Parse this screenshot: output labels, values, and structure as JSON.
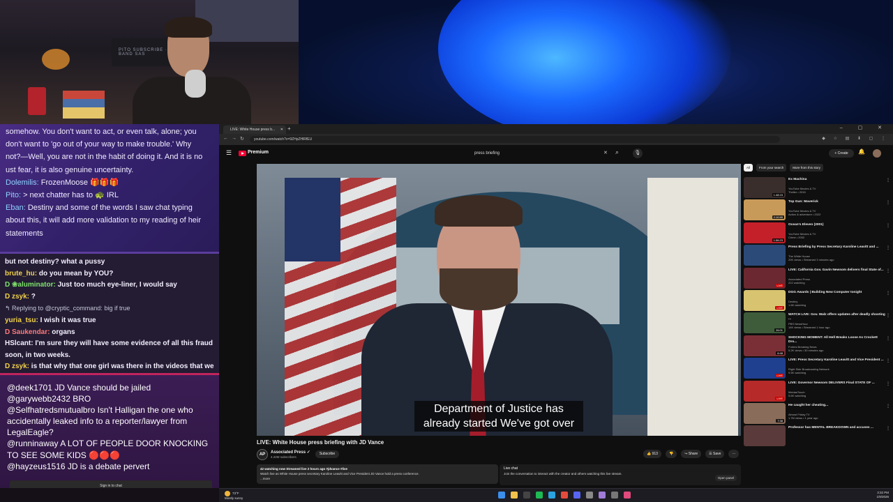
{
  "webcam": {
    "sign_text": "PITO SUBSCRIBE · BAND SAS"
  },
  "chat_top": {
    "lines": [
      "somehow. You don't want to act, or even talk, alone; you",
      "don't want to 'go out of your way to make trouble.' Why",
      "not?—Well, you are not in the habit of doing it. And it is no",
      "ust fear, it is also genuine uncertainty."
    ],
    "messages": [
      {
        "user": "Dolemilis:",
        "text": "FrozenMoose 🎁🎁🎁"
      },
      {
        "user": "Pito:",
        "text": "> next chatter has to 🐢 IRL"
      },
      {
        "user": "Eban:",
        "text": "Destiny and some of the words I saw chat typing about this, it will add more validation to my reading of heir statements"
      }
    ]
  },
  "chat_mid": {
    "messages": [
      {
        "user": "",
        "text": "but not destiny? what a pussy"
      },
      {
        "user": "brute_hu:",
        "text": "do you mean by YOU?"
      },
      {
        "user": "D ❀aluminator:",
        "text": "Just too much eye-liner, I would say"
      },
      {
        "user": "D zsyk:",
        "text": "?"
      },
      {
        "user": "↰ Replying to @cryptic_command:",
        "text": "big if true"
      },
      {
        "user": "yuria_tsu:",
        "text": "I wish it was true"
      },
      {
        "user": "D Saukendar:",
        "text": "organs"
      },
      {
        "user": "HSlcant:",
        "text": "I'm sure they will have some evidence of all this fraud soon, in two weeks."
      },
      {
        "user": "D zsyk:",
        "text": "is that why that one girl was there in the videos that we were watching this morning with dan and moot????"
      }
    ]
  },
  "chat_bottom": {
    "messages": [
      {
        "user": "@deek1701",
        "text": "JD Vance should be jailed"
      },
      {
        "user": "@garywebb2432",
        "text": "BRO"
      },
      {
        "user": "@Selfhatredsmutualbro",
        "text": "Isn't Halligan the one who accidentally leaked info to a reporter/lawyer from LegalEagle?"
      },
      {
        "user": "@runninaway",
        "text": "A LOT OF PEOPLE DOOR KNOCKING TO SEE SOME KIDS 🔴🔴🔴"
      },
      {
        "user": "@hayzeus1516",
        "text": "JD is a debate pervert"
      }
    ],
    "signin": "Sign in to chat"
  },
  "browser": {
    "tab_title": "LIVE: White House press b...",
    "url": "youtube.com/watch?v=9ZHpZHlRfEU",
    "new_tab": "+",
    "window_controls": "– ▢ ✕"
  },
  "youtube": {
    "brand": "Premium",
    "search_value": "press briefing",
    "create_label": "+ Create",
    "caption_line1": "Department of Justice has",
    "caption_line2": "already started We've got over",
    "video_title": "LIVE: White House press briefing with JD Vance",
    "channel_name": "Associated Press ✓",
    "channel_avatar": "AP",
    "channel_subs": "4.22M subscribers",
    "subscribe_label": "Subscribe",
    "likes": "👍 913",
    "dislike": "👎",
    "share": "↪ Share",
    "save": "☰ Save",
    "more": "···",
    "desc_stats": "42 watching now  Streamed live 2 hours ago  #jdvance #live",
    "desc_text": "Watch live as White House press secretary Karoline Leavitt and Vice President JD Vance hold a press conference.",
    "desc_more": "...more",
    "livechat_title": "Live chat",
    "livechat_text": "Join the conversation to interact with the creator and others watching this live stream.",
    "open_panel": "Open panel"
  },
  "sidebar": {
    "chips": [
      "All",
      "From your search",
      "More from this story"
    ],
    "recommendations": [
      {
        "title": "Ex Machina",
        "channel": "YouTube Movies & TV",
        "meta": "Thriller • 2015",
        "badge": "1:48:15",
        "live": false,
        "color": "#3a2e2c"
      },
      {
        "title": "Top Gun: Maverick",
        "channel": "YouTube Movies & TV",
        "meta": "Action & adventure • 2022",
        "badge": "2:10:55",
        "live": false,
        "color": "#c89a5a"
      },
      {
        "title": "Ocean's Eleven (2001)",
        "channel": "YouTube Movies & TV",
        "meta": "Crime • 2002",
        "badge": "1:56:23",
        "live": false,
        "color": "#c4202a"
      },
      {
        "title": "Press Briefing by Press Secretary Karoline Leavitt and ...",
        "channel": "The White House",
        "meta": "20K views • Streamed 3 minutes ago",
        "badge": "",
        "live": false,
        "color": "#2b4a78"
      },
      {
        "title": "LIVE: California Gov. Gavin Newsom delivers final State of...",
        "channel": "Associated Press",
        "meta": "222 watching",
        "badge": "LIVE",
        "live": true,
        "color": "#6b2830"
      },
      {
        "title": "DGG Awards | Building New Computer tonight",
        "channel": "Destiny",
        "meta": "1.6K watching",
        "badge": "LIVE",
        "live": true,
        "color": "#d8c470"
      },
      {
        "title": "WATCH LIVE: Gov. Walz offers updates after deadly shooting ...",
        "channel": "PBS NewsHour",
        "meta": "14K views • Streamed 1 hour ago",
        "badge": "26:01",
        "live": false,
        "color": "#3e5c3a"
      },
      {
        "title": "SHOCKING MOMENT: All Hell Breaks Loose As Crockett Dro...",
        "channel": "Forbes Breaking News",
        "meta": "5.2K views • 30 minutes ago",
        "badge": "6:48",
        "live": false,
        "color": "#7a2f36"
      },
      {
        "title": "LIVE: Press Secretary Karoline Leavitt and Vice President ...",
        "channel": "Right Side Broadcasting Network",
        "meta": "9.5K watching",
        "badge": "LIVE",
        "live": true,
        "color": "#1f3f8f"
      },
      {
        "title": "LIVE: Governor Newsom DELIVERS Final STATE OF ...",
        "channel": "MeidasTouch",
        "meta": "5.6K watching",
        "badge": "LIVE",
        "live": true,
        "color": "#b62a2a"
      },
      {
        "title": "He caught her cheating...",
        "channel": "Almost Friday TV",
        "meta": "1.7M views • 1 year ago",
        "badge": "7:38",
        "live": false,
        "color": "#8a6c5a"
      },
      {
        "title": "Professor has MENTAL BREAKDOWN and accuses ...",
        "channel": "",
        "meta": "",
        "badge": "",
        "live": false,
        "color": "#5a3a3a"
      }
    ]
  },
  "taskbar": {
    "weather_temp": "73°F",
    "weather_desc": "Mostly sunny",
    "time": "3:32 PM",
    "date": "1/9/2026",
    "icons": [
      {
        "name": "windows-start-icon",
        "color": "#3b8eea"
      },
      {
        "name": "file-explorer-icon",
        "color": "#f0c14b"
      },
      {
        "name": "terminal-icon",
        "color": "#444"
      },
      {
        "name": "spotify-icon",
        "color": "#1db954"
      },
      {
        "name": "edge-icon",
        "color": "#2aa3e0"
      },
      {
        "name": "chrome-icon",
        "color": "#e54b3c"
      },
      {
        "name": "discord-icon",
        "color": "#5865f2"
      },
      {
        "name": "settings-icon",
        "color": "#888"
      },
      {
        "name": "obs-icon",
        "color": "#a07bd8"
      },
      {
        "name": "app-icon",
        "color": "#777"
      },
      {
        "name": "active-app-icon",
        "color": "#e04a7c"
      }
    ]
  }
}
